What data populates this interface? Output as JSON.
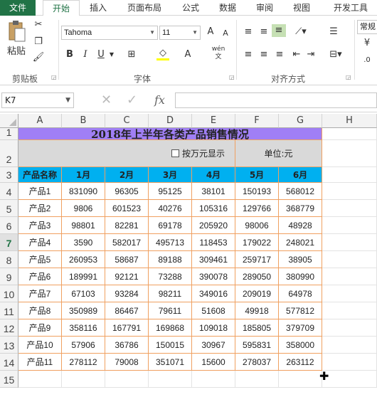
{
  "tabs": [
    "文件",
    "开始",
    "插入",
    "页面布局",
    "公式",
    "数据",
    "审阅",
    "视图",
    "开发工具"
  ],
  "ribbon": {
    "paste_label": "粘贴",
    "font_name": "Tahoma",
    "font_size": "11",
    "number_format": "常规",
    "groups": [
      "剪贴板",
      "字体",
      "对齐方式"
    ],
    "bold": "B",
    "italic": "I",
    "underline": "U",
    "grow": "A",
    "shrink": "A",
    "font_color": "A",
    "wen": "wén"
  },
  "formula_bar": {
    "name_box": "K7",
    "fx": "fx",
    "value": ""
  },
  "columns": [
    "A",
    "B",
    "C",
    "D",
    "E",
    "F",
    "G",
    "H"
  ],
  "rows": [
    "1",
    "2",
    "3",
    "4",
    "5",
    "6",
    "7",
    "8",
    "9",
    "10",
    "11",
    "12",
    "13",
    "14",
    "15"
  ],
  "sheet": {
    "title": "2018年上半年各类产品销售情况",
    "checkbox_label": "按万元显示",
    "unit": "单位:元",
    "headers": [
      "产品名称",
      "1月",
      "2月",
      "3月",
      "4月",
      "5月",
      "6月"
    ],
    "data": [
      [
        "产品1",
        "831090",
        "96305",
        "95125",
        "38101",
        "150193",
        "568012"
      ],
      [
        "产品2",
        "9806",
        "601523",
        "40276",
        "105316",
        "129766",
        "368779"
      ],
      [
        "产品3",
        "98801",
        "82281",
        "69178",
        "205920",
        "98006",
        "48928"
      ],
      [
        "产品4",
        "3590",
        "582017",
        "495713",
        "118453",
        "179022",
        "248021"
      ],
      [
        "产品5",
        "260953",
        "58687",
        "89188",
        "309461",
        "259717",
        "38905"
      ],
      [
        "产品6",
        "189991",
        "92121",
        "73288",
        "390078",
        "289050",
        "380990"
      ],
      [
        "产品7",
        "67103",
        "93284",
        "98211",
        "349016",
        "209019",
        "64978"
      ],
      [
        "产品8",
        "350989",
        "86467",
        "79611",
        "51608",
        "49918",
        "577812"
      ],
      [
        "产品9",
        "358116",
        "167791",
        "169868",
        "109018",
        "185805",
        "379709"
      ],
      [
        "产品10",
        "57906",
        "36786",
        "150015",
        "30967",
        "595831",
        "358000"
      ],
      [
        "产品11",
        "278112",
        "79008",
        "351071",
        "15600",
        "278037",
        "263112"
      ]
    ]
  },
  "colors": {
    "title_bg": "#a07ff5",
    "header_bg": "#00b0f0",
    "border": "#f0a060",
    "accent": "#217346"
  }
}
